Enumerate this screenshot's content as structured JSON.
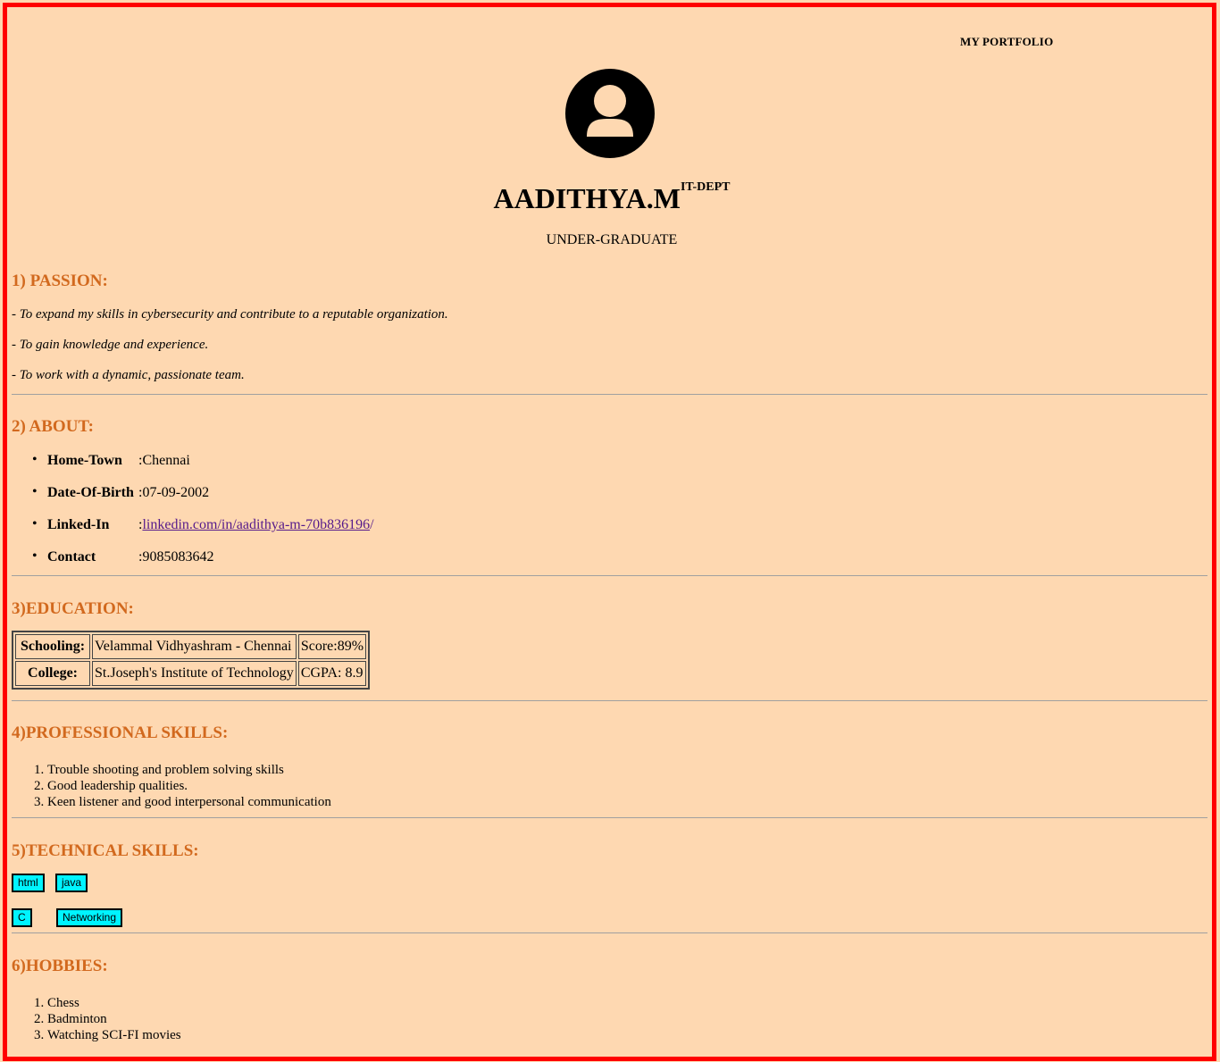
{
  "nav": {
    "label": "MY PORTFOLIO"
  },
  "profile": {
    "avatar_icon": "user-avatar-icon",
    "name": "AADITHYA.M",
    "dept": "IT-DEPT",
    "level": "UNDER-GRADUATE"
  },
  "passion": {
    "title": "1) PASSION:",
    "items": [
      "- To expand my skills in cybersecurity and contribute to a reputable organization.",
      "- To gain knowledge and experience.",
      "- To work with a dynamic, passionate team."
    ]
  },
  "about": {
    "title": "2) ABOUT:",
    "items": [
      {
        "key": "Home-Town",
        "sep": ":",
        "value": "Chennai"
      },
      {
        "key": "Date-Of-Birth",
        "sep": ":",
        "value": "07-09-2002"
      },
      {
        "key": "Linked-In",
        "sep": ":",
        "value": "linkedin.com/in/aadithya-m-70b836196",
        "suffix": "/"
      },
      {
        "key": "Contact",
        "sep": ":",
        "value": "9085083642"
      }
    ]
  },
  "education": {
    "title": "3)EDUCATION:",
    "rows": [
      {
        "label": "Schooling:",
        "institution": "Velammal Vidhyashram - Chennai",
        "score": "Score:89%"
      },
      {
        "label": "College:",
        "institution": "St.Joseph's Institute of Technology",
        "score": "CGPA: 8.9"
      }
    ]
  },
  "professional": {
    "title": "4)PROFESSIONAL SKILLS:",
    "items": [
      "Trouble shooting and problem solving skills",
      "Good leadership qualities.",
      "Keen listener and good interpersonal communication"
    ]
  },
  "technical": {
    "title": "5)TECHNICAL SKILLS:",
    "tags": [
      "html",
      "java",
      "C",
      "Networking"
    ],
    "tag_color": "#00f4ff"
  },
  "hobbies": {
    "title": "6)HOBBIES:",
    "items": [
      "Chess",
      "Badminton",
      "Watching SCI-FI movies"
    ]
  },
  "colors": {
    "background": "#fed8b1",
    "frame": "#ff0000",
    "heading": "#d2691e",
    "link": "#551a8b"
  }
}
